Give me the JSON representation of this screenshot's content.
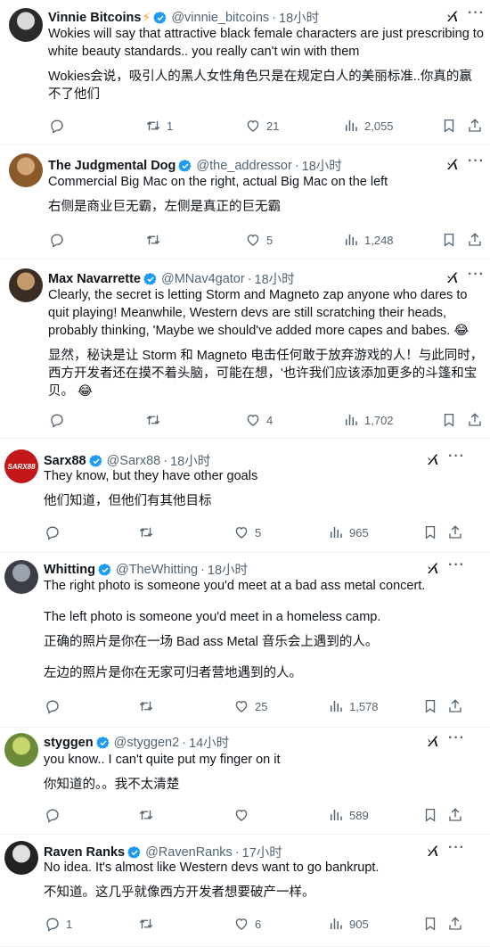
{
  "tweets": [
    {
      "name": "Vinnie Bitcoins",
      "emoji": "⚡",
      "handle": "@vinnie_bitcoins",
      "time": "18小时",
      "text": [
        "Wokies will say that attractive black female characters are just prescribing to white beauty standards.. you really can't win with them"
      ],
      "translation": [
        "Wokies会说，吸引人的黑人女性角色只是在规定白人的美丽标准..你真的赢不了他们"
      ],
      "stats": {
        "replies": "",
        "retweets": "1",
        "likes": "21",
        "views": "2,055"
      }
    },
    {
      "name": "The Judgmental Dog",
      "handle": "@the_addressor",
      "time": "18小时",
      "text": [
        "Commercial Big Mac on the right, actual Big Mac on the left"
      ],
      "translation": [
        "右侧是商业巨无霸，左侧是真正的巨无霸"
      ],
      "stats": {
        "replies": "",
        "retweets": "",
        "likes": "5",
        "views": "1,248"
      }
    },
    {
      "name": "Max Navarrette",
      "handle": "@MNav4gator",
      "time": "18小时",
      "text": [
        "Clearly, the secret is letting Storm and Magneto zap anyone who dares to quit playing! Meanwhile, Western devs are still scratching their heads, probably thinking, 'Maybe we should've added more capes and babes. 😂"
      ],
      "translation": [
        "显然，秘诀是让 Storm 和 Magneto 电击任何敢于放弃游戏的人！与此同时，西方开发者还在摸不着头脑，可能在想，'也许我们应该添加更多的斗篷和宝贝。 😂"
      ],
      "stats": {
        "replies": "",
        "retweets": "",
        "likes": "4",
        "views": "1,702"
      }
    },
    {
      "name": "Sarx88",
      "handle": "@Sarx88",
      "time": "18小时",
      "avatar_text": "SARX88",
      "text": [
        "They know, but they have other goals"
      ],
      "translation": [
        "他们知道，但他们有其他目标"
      ],
      "stats": {
        "replies": "",
        "retweets": "",
        "likes": "5",
        "views": "965"
      }
    },
    {
      "name": "Whitting",
      "handle": "@TheWhitting",
      "time": "18小时",
      "text": [
        "The right photo is someone you'd meet at a bad ass metal concert.",
        "The left photo is someone you'd meet in a homeless camp."
      ],
      "translation": [
        "正确的照片是你在一场 Bad ass Metal 音乐会上遇到的人。",
        "左边的照片是你在无家可归者营地遇到的人。"
      ],
      "stats": {
        "replies": "",
        "retweets": "",
        "likes": "25",
        "views": "1,578"
      }
    },
    {
      "name": "styggen",
      "handle": "@styggen2",
      "time": "14小时",
      "text": [
        "you know.. I can't quite put my finger on it"
      ],
      "translation": [
        "你知道的。。我不太清楚"
      ],
      "stats": {
        "replies": "",
        "retweets": "",
        "likes": "",
        "views": "589"
      }
    },
    {
      "name": "Raven Ranks",
      "handle": "@RavenRanks",
      "time": "17小时",
      "text": [
        "No idea. It's almost like Western devs want to go bankrupt."
      ],
      "translation": [
        "不知道。这几乎就像西方开发者想要破产一样。"
      ],
      "stats": {
        "replies": "1",
        "retweets": "",
        "likes": "6",
        "views": "905"
      }
    }
  ],
  "more_label": "···",
  "colors": {
    "verified": "#1d9bf0",
    "secondary": "#536471",
    "divider": "#eff3f4"
  }
}
